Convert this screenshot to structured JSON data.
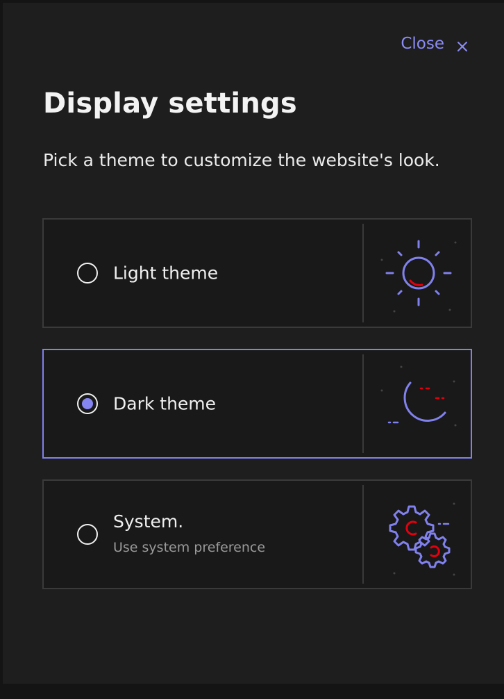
{
  "dialog": {
    "close_label": "Close",
    "title": "Display settings",
    "description": "Pick a theme to customize the website's look."
  },
  "options": [
    {
      "label": "Light theme",
      "sublabel": "",
      "selected": false,
      "icon": "sun-icon"
    },
    {
      "label": "Dark theme",
      "sublabel": "",
      "selected": true,
      "icon": "moon-icon"
    },
    {
      "label": "System.",
      "sublabel": "Use system preference",
      "selected": false,
      "icon": "gears-icon"
    }
  ],
  "colors": {
    "accent": "#8181ee",
    "highlight": "#e1000f",
    "background": "#1e1e1e",
    "text": "#f0f0f0"
  }
}
